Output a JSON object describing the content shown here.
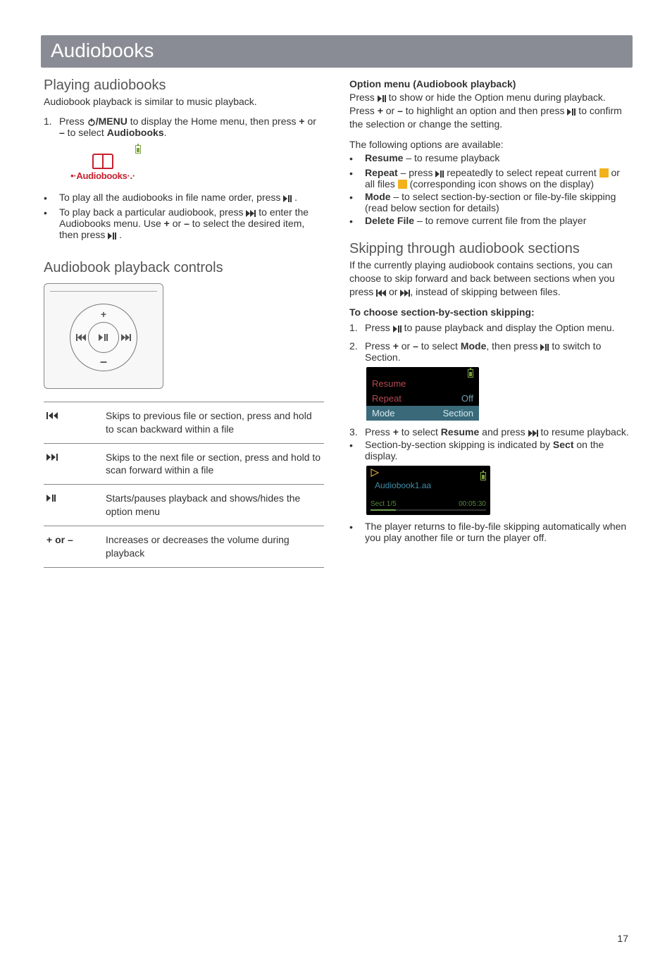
{
  "page": {
    "title": "Audiobooks",
    "number": "17"
  },
  "left": {
    "h_playing": "Playing audiobooks",
    "p_playing": "Audiobook playback is similar to music playback.",
    "step1_num": "1.",
    "step1_a": "Press ",
    "step1_b": "/MENU",
    "step1_c": " to display the Home menu, then press ",
    "step1_d": "+",
    "step1_e": " or ",
    "step1_f": "–",
    "step1_g": " to select ",
    "step1_h": "Audiobooks",
    "step1_i": ".",
    "device_label": "Audiobooks",
    "b1": "To play all the audiobooks in file name order, press ",
    "b1_end": " .",
    "b2_a": "To play back a particular audiobook, press ",
    "b2_b": " to enter the Audiobooks menu. Use ",
    "b2_c": "+",
    "b2_d": " or ",
    "b2_e": "–",
    "b2_f": " to select the desired item, then press ",
    "b2_g": " .",
    "h_controls": "Audiobook playback controls",
    "table": {
      "r1": "Skips to previous file or section, press and hold to scan backward within a file",
      "r2": "Skips to the next file or section, press and hold to scan forward within a file",
      "r3": "Starts/pauses playback and shows/hides the option menu",
      "r4_key": "+ or –",
      "r4": "Increases or decreases the volume during playback"
    }
  },
  "right": {
    "h_option": "Option menu (Audiobook playback)",
    "p_option_a": "Press ",
    "p_option_b": " to show or hide the Option menu during playback. Press ",
    "p_option_c": "+",
    "p_option_d": " or ",
    "p_option_e": "–",
    "p_option_f": " to highlight an option and then press ",
    "p_option_g": " to confirm the selection or change the setting.",
    "p_following": "The following options are available:",
    "opt1_a": "Resume",
    "opt1_b": " – to resume playback",
    "opt2_a": "Repeat",
    "opt2_b": " – press ",
    "opt2_c": " repeatedly to select repeat current ",
    "opt2_d": " or all files ",
    "opt2_e": " (corresponding icon shows on the display)",
    "opt3_a": "Mode",
    "opt3_b": " – to select section-by-section or file-by-file skipping (read below section for details)",
    "opt4_a": "Delete File",
    "opt4_b": " – to remove current file from the player",
    "h_skip": "Skipping through audiobook sections",
    "p_skip_a": "If the currently playing audiobook contains sections, you can choose to skip forward and back between sections when you press ",
    "p_skip_b": " or ",
    "p_skip_c": ", instead of skipping between files.",
    "h_choose": "To choose section-by-section skipping:",
    "s1_num": "1.",
    "s1_a": "Press ",
    "s1_b": " to pause playback and display the Option menu.",
    "s2_num": "2.",
    "s2_a": "Press ",
    "s2_b": "+",
    "s2_c": " or ",
    "s2_d": "–",
    "s2_e": " to select ",
    "s2_f": "Mode",
    "s2_g": ", then press ",
    "s2_h": " to switch to Section.",
    "screen1": {
      "resume": "Resume",
      "repeat": "Repeat",
      "off": "Off",
      "mode": "Mode",
      "section": "Section"
    },
    "s3_num": "3.",
    "s3_a": "Press ",
    "s3_b": "+",
    "s3_c": " to select ",
    "s3_d": "Resume",
    "s3_e": " and press ",
    "s3_f": " to resume playback.",
    "sb_a": "Section-by-section skipping is indicated by ",
    "sb_b": "Sect",
    "sb_c": " on the display.",
    "screen2": {
      "fname": "Audiobook1.aa",
      "sect": "Sect 1/5",
      "time": "00:05:30"
    },
    "last": "The player returns to file-by-file skipping automatically when you play another file or turn the player off."
  }
}
